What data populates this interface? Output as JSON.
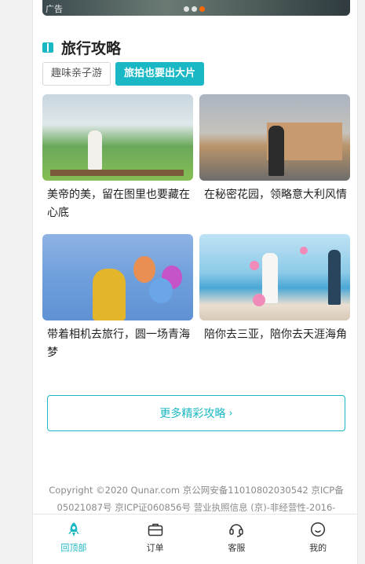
{
  "banner": {
    "ad_label": "广告"
  },
  "section": {
    "title": "旅行攻略"
  },
  "tags": [
    {
      "label": "趣味亲子游",
      "active": false
    },
    {
      "label": "旅拍也要出大片",
      "active": true
    }
  ],
  "cards": [
    {
      "caption": "美帝的美，留在图里也要藏在心底"
    },
    {
      "caption": "在秘密花园，领略意大利风情"
    },
    {
      "caption": "带着相机去旅行，圆一场青海梦"
    },
    {
      "caption": "陪你去三亚，陪你去天涯海角"
    }
  ],
  "more": {
    "label": "更多精彩攻略"
  },
  "footer": {
    "line1": "Copyright ©2020 Qunar.com  京公网安备11010802030542  京ICP备",
    "line2": "05021087号  京ICP证060856号  营业执照信息  (京)-非经营性-2016-"
  },
  "tabbar": [
    {
      "label": "回顶部",
      "icon": "rocket-icon",
      "active": true
    },
    {
      "label": "订单",
      "icon": "briefcase-icon",
      "active": false
    },
    {
      "label": "客服",
      "icon": "headset-icon",
      "active": false
    },
    {
      "label": "我的",
      "icon": "smiley-icon",
      "active": false
    }
  ],
  "colors": {
    "accent": "#1ab8c4"
  }
}
